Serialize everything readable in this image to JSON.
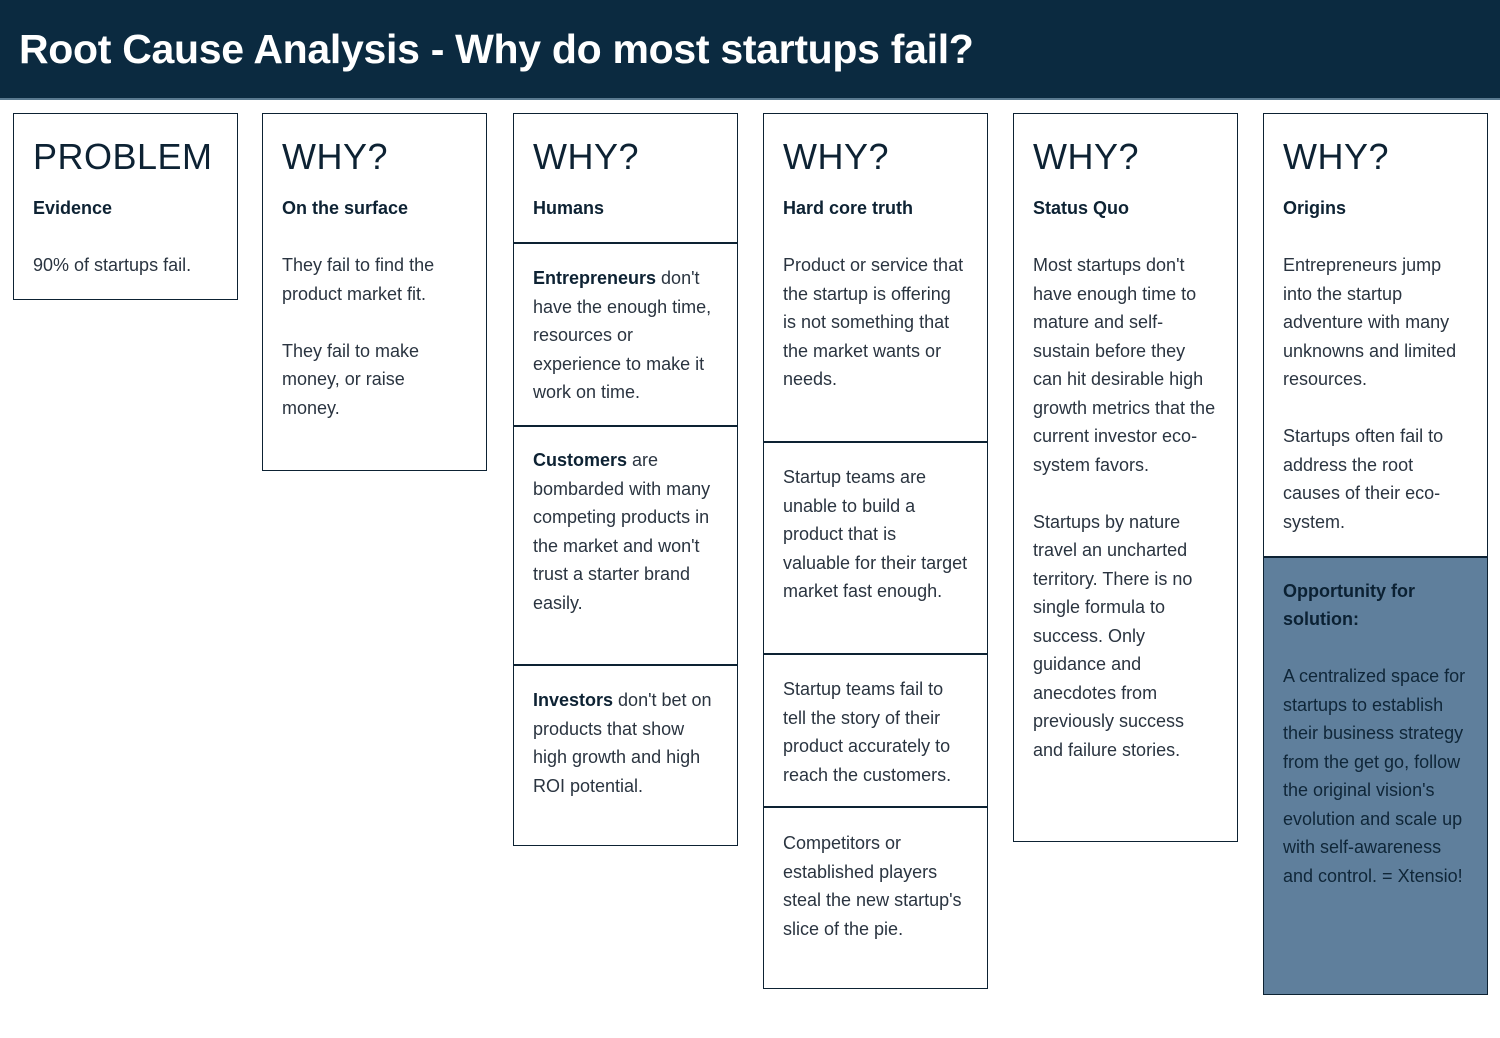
{
  "header": {
    "title": "Root Cause Analysis - Why do most startups fail?"
  },
  "colors": {
    "header_bg": "#0b2a40",
    "border": "#0d2233",
    "solution_bg": "#5f7f9c",
    "text": "#2a3440"
  },
  "columns": [
    {
      "heading": "PROBLEM",
      "subheading": "Evidence",
      "paragraphs": [
        "90% of startups fail."
      ]
    },
    {
      "heading": "WHY?",
      "subheading": "On the surface",
      "paragraphs": [
        "They fail to find the product market fit.",
        "They fail to make money, or raise money."
      ]
    },
    {
      "heading": "WHY?",
      "subheading": "Humans",
      "cells": [
        {
          "bold": "Entrepreneurs",
          "text": " don't have the enough time, resources or experience to make it work on time."
        },
        {
          "bold": "Customers",
          "text": " are bombarded with many competing products in the market and won't trust a starter brand easily."
        },
        {
          "bold": "Investors",
          "text": " don't bet on products that show high growth and high ROI potential."
        }
      ]
    },
    {
      "heading": "WHY?",
      "subheading": "Hard core truth",
      "first_text": "Product or service that the startup is offering is not something that the market wants or needs.",
      "cells": [
        "Startup teams are unable to build a product that is valuable for their target market fast enough.",
        "Startup teams fail to tell the story of their product accurately to reach the customers.",
        "Competitors or established players steal the new startup's slice of the pie."
      ]
    },
    {
      "heading": "WHY?",
      "subheading": "Status Quo",
      "paragraphs": [
        "Most startups don't have enough time to mature and self-sustain before they can hit desirable high growth metrics that the current investor eco-system favors.",
        "Startups by nature travel an uncharted territory. There is no single formula to success. Only guidance and anecdotes from previously success and failure stories."
      ]
    },
    {
      "heading": "WHY?",
      "subheading": "Origins",
      "paragraphs": [
        "Entrepreneurs jump into the startup adventure with many unknowns and limited resources.",
        "Startups often fail to address the root causes of their eco-system."
      ],
      "solution": {
        "title": "Opportunity for solution:",
        "text": "A centralized space for startups to establish their business strategy from the get go, follow the original vision's evolution and scale up with self-awareness and control. = Xtensio!"
      }
    }
  ]
}
